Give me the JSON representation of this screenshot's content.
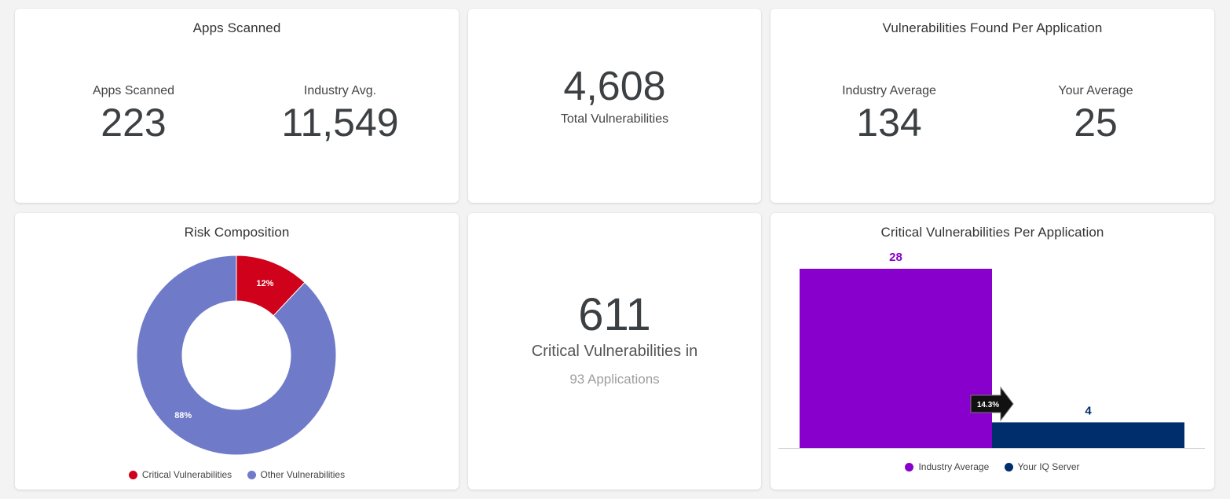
{
  "apps_scanned": {
    "title": "Apps Scanned",
    "left_label": "Apps Scanned",
    "left_value": "223",
    "right_label": "Industry Avg.",
    "right_value": "11,549"
  },
  "total_vulnerabilities": {
    "value": "4,608",
    "label": "Total Vulnerabilities"
  },
  "vulns_per_app": {
    "title": "Vulnerabilities Found Per Application",
    "left_label": "Industry Average",
    "left_value": "134",
    "right_label": "Your Average",
    "right_value": "25"
  },
  "risk_composition": {
    "title": "Risk Composition",
    "legend": [
      {
        "label": "Critical Vulnerabilities",
        "color": "#d0021b"
      },
      {
        "label": "Other Vulnerabilities",
        "color": "#6f7bc8"
      }
    ]
  },
  "critical_summary": {
    "value": "611",
    "line1": "Critical Vulnerabilities in",
    "line2": "93 Applications"
  },
  "critical_per_app": {
    "title": "Critical Vulnerabilities Per Application",
    "badge": "14.3%",
    "legend": [
      {
        "label": "Industry Average",
        "color": "#8800cc"
      },
      {
        "label": "Your IQ Server",
        "color": "#002d6b"
      }
    ]
  },
  "chart_data": [
    {
      "type": "pie",
      "title": "Risk Composition",
      "donut": true,
      "slices": [
        {
          "label": "Critical Vulnerabilities",
          "value": 12,
          "display": "12%",
          "color": "#d0021b"
        },
        {
          "label": "Other Vulnerabilities",
          "value": 88,
          "display": "88%",
          "color": "#6f7bc8"
        }
      ],
      "legend_position": "bottom"
    },
    {
      "type": "bar",
      "title": "Critical Vulnerabilities Per Application",
      "categories": [
        "Industry Average",
        "Your IQ Server"
      ],
      "values": [
        28,
        4
      ],
      "colors": [
        "#8800cc",
        "#002d6b"
      ],
      "value_label_colors": [
        "#8800cc",
        "#002d6b"
      ],
      "ylim": [
        0,
        28
      ],
      "grid": false,
      "legend_position": "bottom"
    }
  ]
}
